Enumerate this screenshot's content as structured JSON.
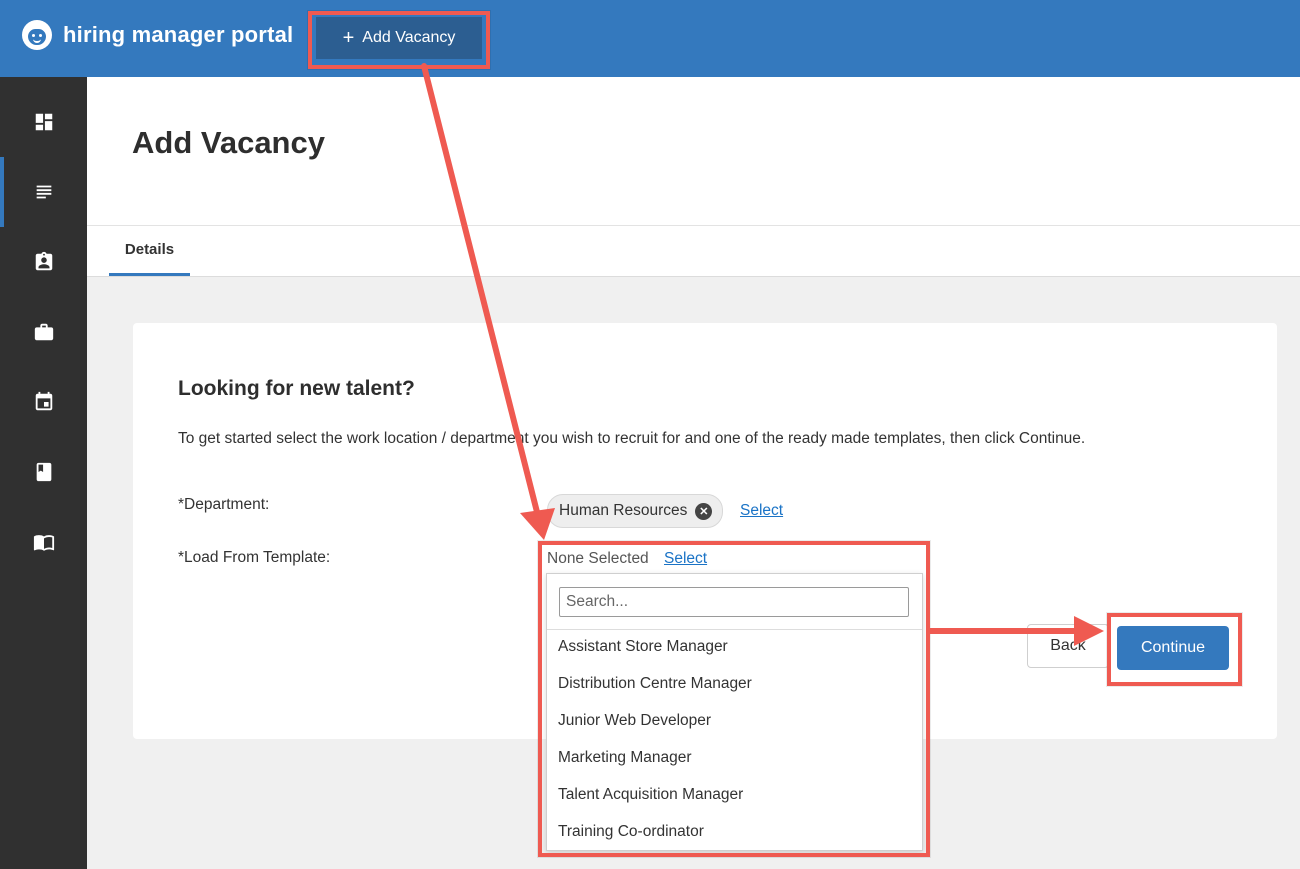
{
  "app": {
    "brand": "hiring manager portal",
    "add_vacancy_label": "Add Vacancy"
  },
  "sidebar": {
    "items": [
      {
        "icon": "dashboard-icon"
      },
      {
        "icon": "list-icon",
        "active": true
      },
      {
        "icon": "clipboard-person-icon"
      },
      {
        "icon": "briefcase-icon"
      },
      {
        "icon": "calendar-icon"
      },
      {
        "icon": "bookmark-book-icon"
      },
      {
        "icon": "open-book-icon"
      }
    ]
  },
  "page": {
    "title": "Add Vacancy",
    "tabs": [
      {
        "label": "Details"
      }
    ]
  },
  "card": {
    "title": "Looking for new talent?",
    "description": "To get started select the work location / department you wish to recruit for and one of the ready made templates, then click Continue.",
    "department": {
      "label": "*Department:",
      "value": "Human Resources",
      "select_label": "Select"
    },
    "template": {
      "label": "*Load From Template:",
      "value": "None Selected",
      "select_label": "Select"
    },
    "back_label": "Back",
    "continue_label": "Continue"
  },
  "dropdown": {
    "search_placeholder": "Search...",
    "options": [
      "Assistant Store Manager",
      "Distribution Centre Manager",
      "Junior Web Developer",
      "Marketing Manager",
      "Talent Acquisition Manager",
      "Training Co-ordinator"
    ]
  },
  "annotation_color": "#ef5a51"
}
